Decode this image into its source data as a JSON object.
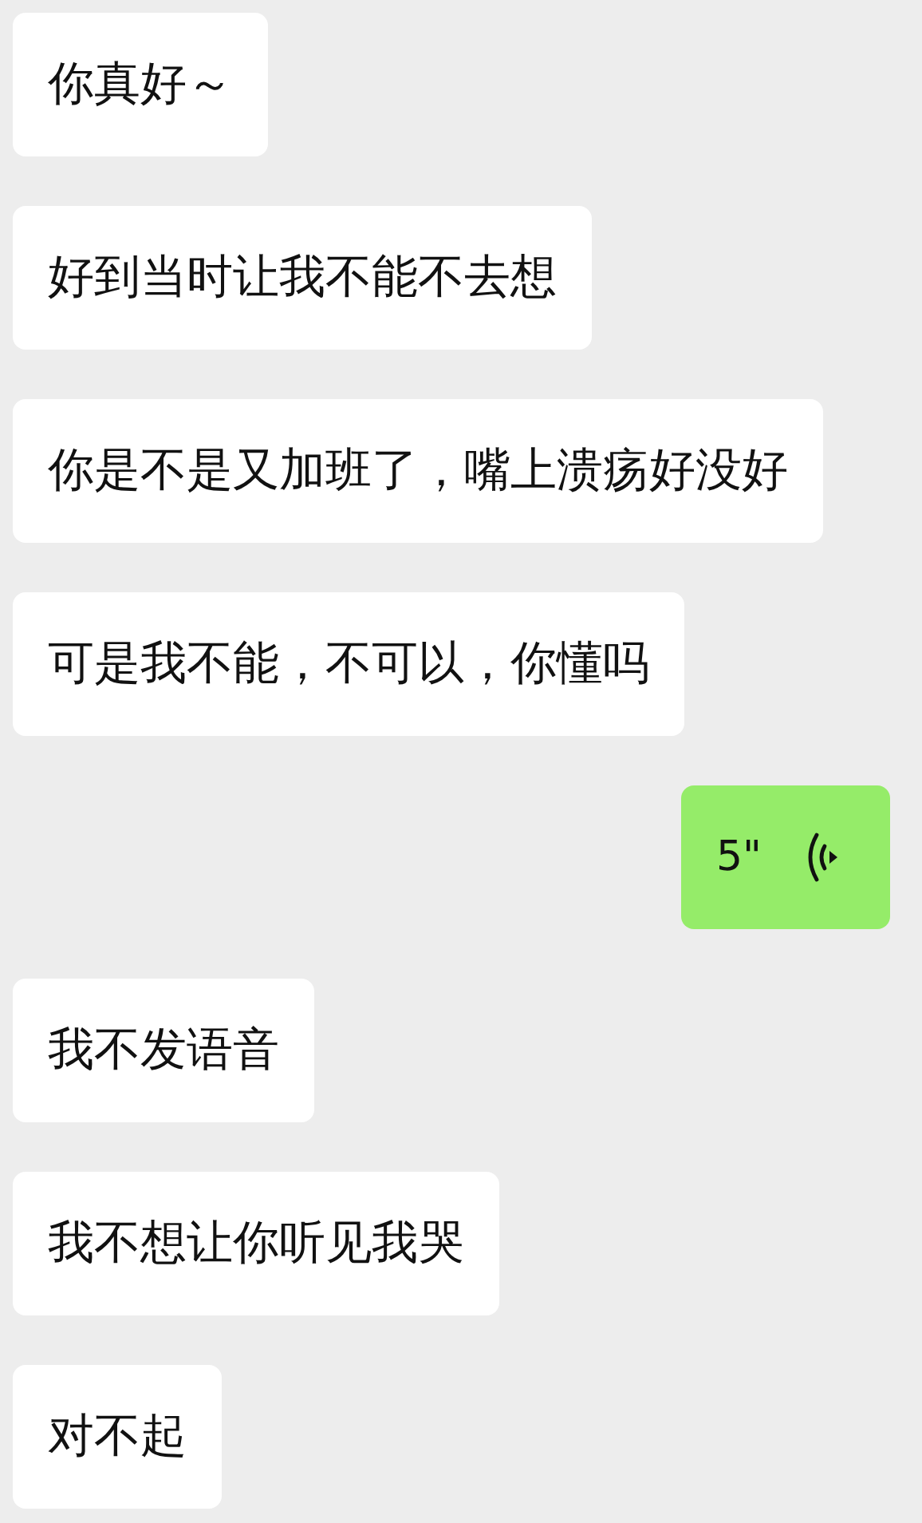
{
  "messages": [
    {
      "kind": "text",
      "outgoing": false,
      "text": "你真好～"
    },
    {
      "kind": "text",
      "outgoing": false,
      "text": "好到当时让我不能不去想"
    },
    {
      "kind": "text",
      "outgoing": false,
      "text": "你是不是又加班了，嘴上溃疡好没好"
    },
    {
      "kind": "text",
      "outgoing": false,
      "text": "可是我不能，不可以，你懂吗"
    },
    {
      "kind": "voice",
      "outgoing": true,
      "duration": "5\""
    },
    {
      "kind": "text",
      "outgoing": false,
      "text": "我不发语音"
    },
    {
      "kind": "text",
      "outgoing": false,
      "text": "我不想让你听见我哭"
    },
    {
      "kind": "text",
      "outgoing": false,
      "text": "对不起"
    }
  ]
}
